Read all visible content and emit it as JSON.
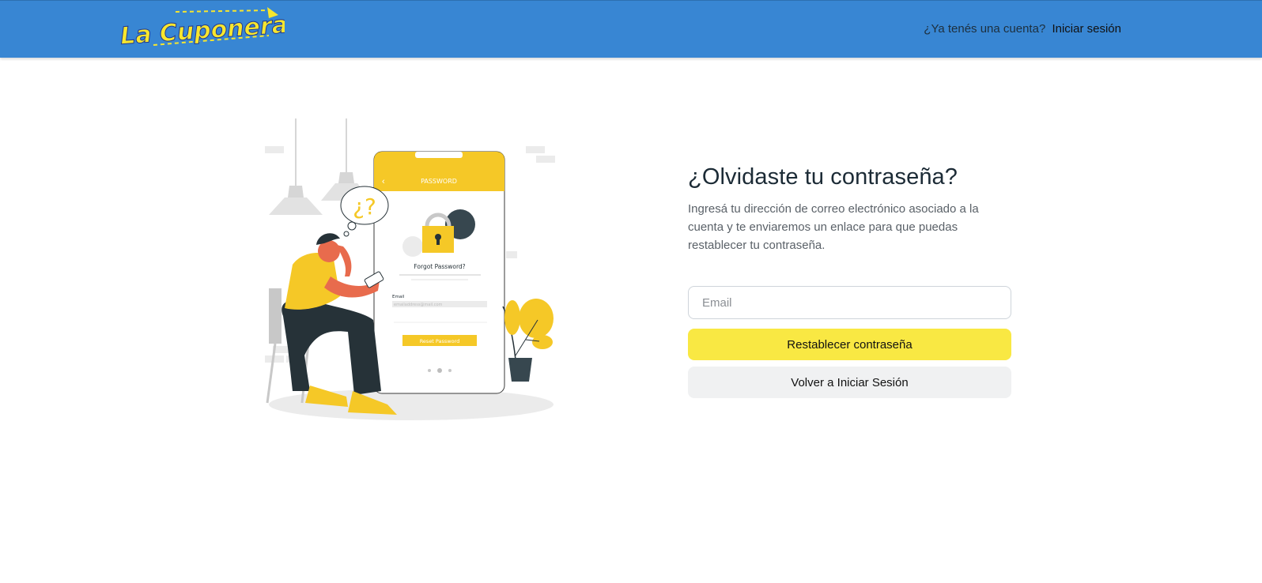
{
  "brand": {
    "name": "La Cuponera",
    "color_text": "#f7e62e",
    "color_outline": "#233a8c"
  },
  "navbar": {
    "background": "#3886d3",
    "question": "¿Ya tenés una cuenta?",
    "login_link": "Iniciar sesión"
  },
  "illustration": {
    "screen_title": "PASSWORD",
    "forgot_label": "Forgot Password?",
    "email_label": "Email",
    "email_placeholder": "emailaddress@mail.com",
    "reset_button": "Reset Password",
    "thought_bubble": "¿?",
    "accent": "#f5c827"
  },
  "form": {
    "title": "¿Olvidaste tu contraseña?",
    "description": "Ingresá tu dirección de correo electrónico asociado a la cuenta y te enviaremos un enlace para que puedas restablecer tu contraseña.",
    "email_placeholder": "Email",
    "email_value": "",
    "reset_button": "Restablecer contraseña",
    "back_button": "Volver a Iniciar Sesión",
    "reset_color": "#f9e843",
    "back_color": "#f0f1f2"
  }
}
